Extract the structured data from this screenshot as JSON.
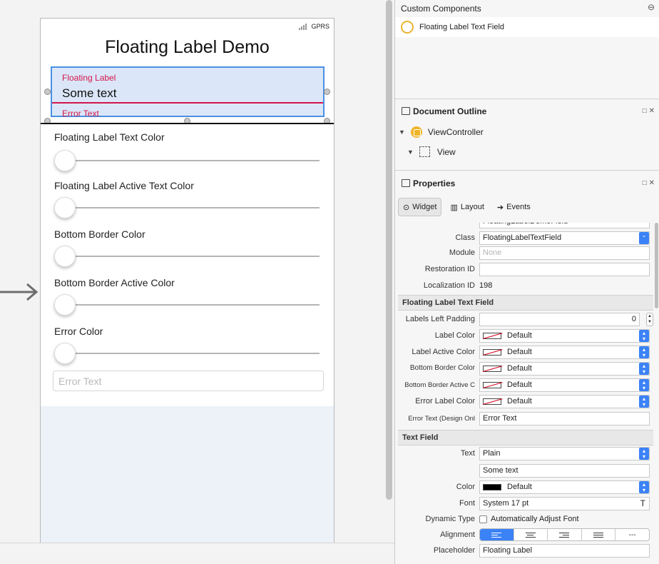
{
  "canvas": {
    "status_bar": {
      "carrier": "GPRS"
    },
    "title": "Floating Label Demo",
    "floating_field": {
      "label": "Floating Label",
      "value": "Some text",
      "error": "Error Text",
      "label_color": "#d5154b",
      "border_color": "#d5154b",
      "selection_color": "#4a90e2"
    },
    "controls": [
      {
        "label": "Floating Label Text Color",
        "slider_value": 0
      },
      {
        "label": "Floating Label Active Text Color",
        "slider_value": 0
      },
      {
        "label": "Bottom Border Color",
        "slider_value": 0
      },
      {
        "label": "Bottom Border Active Color",
        "slider_value": 0
      },
      {
        "label": "Error Color",
        "slider_value": 0
      }
    ],
    "error_input": {
      "placeholder": "Error Text",
      "value": ""
    }
  },
  "custom_components": {
    "title": "Custom Components",
    "items": [
      {
        "name": "Floating Label Text Field"
      }
    ]
  },
  "document_outline": {
    "title": "Document Outline",
    "items": [
      {
        "name": "ViewController"
      },
      {
        "name": "View"
      }
    ]
  },
  "properties": {
    "title": "Properties",
    "tabs": [
      {
        "label": "Widget",
        "active": true
      },
      {
        "label": "Layout",
        "active": false
      },
      {
        "label": "Events",
        "active": false
      }
    ],
    "partial_field_value": "FloatingLabelDemoField",
    "identity": {
      "class": {
        "label": "Class",
        "value": "FloatingLabelTextField"
      },
      "module": {
        "label": "Module",
        "placeholder": "None"
      },
      "restoration_id": {
        "label": "Restoration ID",
        "value": ""
      },
      "localization_id": {
        "label": "Localization ID",
        "value": "198"
      }
    },
    "floating_group": {
      "header": "Floating Label Text Field",
      "labels_left_padding": {
        "label": "Labels Left Padding",
        "value": "0"
      },
      "label_color": {
        "label": "Label Color",
        "value": "Default"
      },
      "label_active_color": {
        "label": "Label Active Color",
        "value": "Default"
      },
      "bottom_border_color": {
        "label": "Bottom Border Color",
        "value": "Default"
      },
      "bottom_border_active": {
        "label": "Bottom Border Active C",
        "value": "Default"
      },
      "error_label_color": {
        "label": "Error Label Color",
        "value": "Default"
      },
      "error_text": {
        "label": "Error Text (Design Onl",
        "value": "Error Text"
      }
    },
    "text_field_group": {
      "header": "Text Field",
      "text": {
        "label": "Text",
        "value": "Plain",
        "content": "Some text"
      },
      "color": {
        "label": "Color",
        "value": "Default"
      },
      "font": {
        "label": "Font",
        "value": "System 17 pt"
      },
      "dynamic_type": {
        "label": "Dynamic Type",
        "checkbox_label": "Automatically Adjust Font",
        "checked": false
      },
      "alignment": {
        "label": "Alignment",
        "selected": "left",
        "last_label": "---"
      },
      "placeholder": {
        "label": "Placeholder",
        "value": "Floating Label"
      }
    }
  }
}
